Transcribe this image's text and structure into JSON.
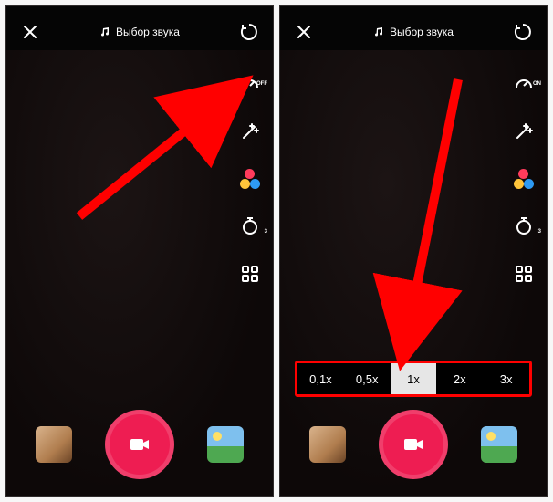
{
  "screens": [
    {
      "header": {
        "sound_label": "Выбор звука"
      },
      "tools": {
        "speed_badge": "OFF",
        "timer_badge": "3"
      },
      "speed_strip": null
    },
    {
      "header": {
        "sound_label": "Выбор звука"
      },
      "tools": {
        "speed_badge": "ON",
        "timer_badge": "3"
      },
      "speed_strip": {
        "options": [
          "0,1x",
          "0,5x",
          "1x",
          "2x",
          "3x"
        ],
        "selected": "1x"
      }
    }
  ],
  "colors": {
    "record": "#ee1d52",
    "annotation": "#ff0000"
  }
}
